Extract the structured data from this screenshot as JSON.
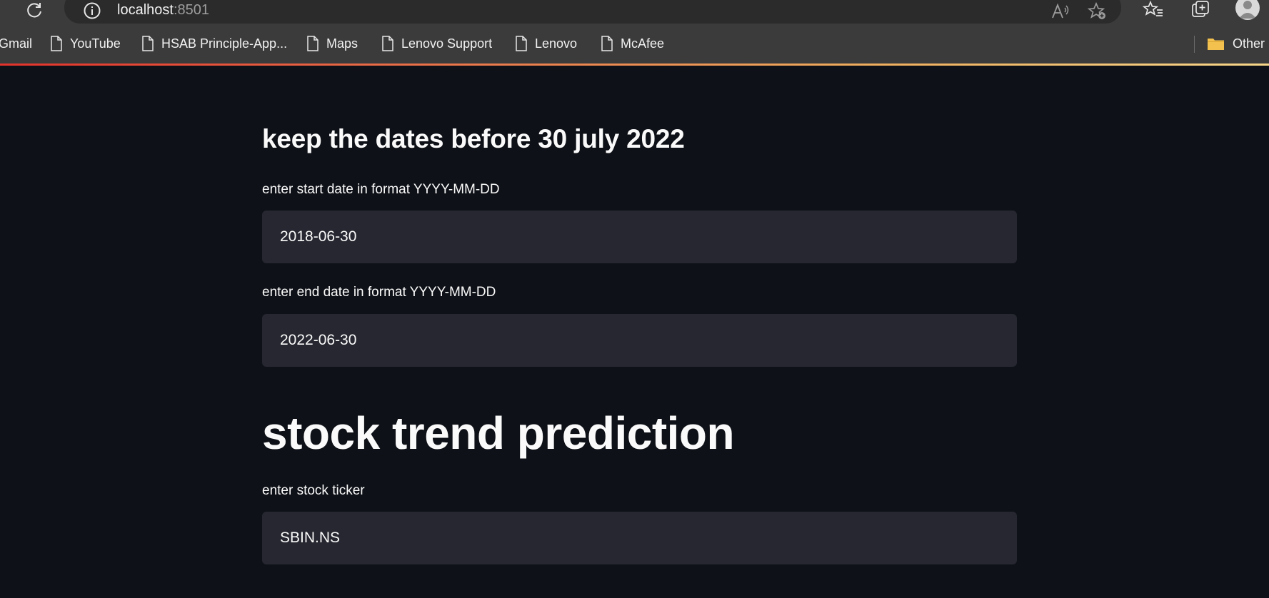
{
  "browser": {
    "url_host": "localhost",
    "url_port": ":8501",
    "bookmarks": [
      {
        "label": "Gmail"
      },
      {
        "label": "YouTube"
      },
      {
        "label": "HSAB Principle-App..."
      },
      {
        "label": "Maps"
      },
      {
        "label": "Lenovo Support"
      },
      {
        "label": "Lenovo"
      },
      {
        "label": "McAfee"
      },
      {
        "label": "Other"
      }
    ],
    "accent_colors": {
      "progress_start": "#e3322b",
      "progress_end": "#f7d68a",
      "folder": "#f2c14e"
    }
  },
  "app": {
    "date_heading": "keep the dates before 30 july 2022",
    "start_date": {
      "label": "enter start date in format YYYY-MM-DD",
      "value": "2018-06-30"
    },
    "end_date": {
      "label": "enter end date in format YYYY-MM-DD",
      "value": "2022-06-30"
    },
    "title": "stock trend prediction",
    "ticker": {
      "label": "enter stock ticker",
      "value": "SBIN.NS"
    },
    "colors": {
      "background": "#0e1117",
      "input_background": "#262730",
      "text": "#fafafa"
    }
  }
}
